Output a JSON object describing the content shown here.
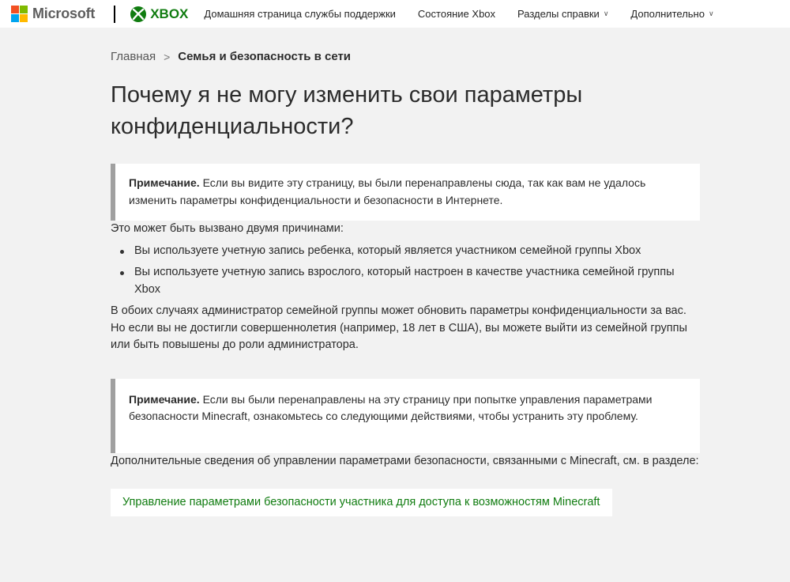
{
  "header": {
    "microsoft_label": "Microsoft",
    "xbox_label": "XBOX",
    "nav": [
      {
        "label": "Домашняя страница службы поддержки",
        "has_dropdown": false
      },
      {
        "label": "Состояние Xbox",
        "has_dropdown": false
      },
      {
        "label": "Разделы справки",
        "has_dropdown": true
      },
      {
        "label": "Дополнительно",
        "has_dropdown": true
      }
    ]
  },
  "breadcrumb": {
    "home": "Главная",
    "separator": ">",
    "current": "Семья и безопасность в сети"
  },
  "article": {
    "title": "Почему я не могу изменить свои параметры конфиденциальности?",
    "note1": {
      "label": "Примечание.",
      "text": "Если вы видите эту страницу, вы были перенаправлены сюда, так как вам не удалось изменить параметры конфиденциальности и безопасности в Интернете."
    },
    "intro": "Это может быть вызвано двумя причинами:",
    "reasons": [
      "Вы используете учетную запись ребенка, который является участником семейной группы Xbox",
      "Вы используете учетную запись взрослого, который настроен в качестве участника семейной группы Xbox"
    ],
    "paragraph2": "В обоих случаях администратор семейной группы может обновить параметры конфиденциальности за вас. Но если вы не достигли совершеннолетия (например, 18 лет в США), вы можете выйти из семейной группы или быть повышены до роли администратора.",
    "note2": {
      "label": "Примечание.",
      "text": "Если вы были перенаправлены на эту страницу при попытке управления параметрами безопасности Minecraft, ознакомьтесь со следующими действиями, чтобы устранить эту проблему."
    },
    "paragraph3": "Дополнительные сведения об управлении параметрами безопасности, связанными с Minecraft, см. в разделе:",
    "link": "Управление параметрами безопасности участника для доступа к возможностям Minecraft"
  },
  "colors": {
    "xbox_green": "#107c10",
    "background": "#f2f2f2",
    "note_border": "#a0a0a0",
    "ms_red": "#f25022",
    "ms_green": "#7fba00",
    "ms_blue": "#00a4ef",
    "ms_yellow": "#ffb900"
  }
}
